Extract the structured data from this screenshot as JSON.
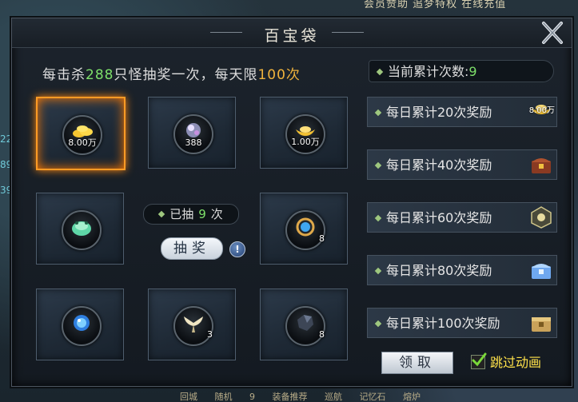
{
  "top_bar": {
    "text": "会员赞助  追梦特权  在线充值"
  },
  "bottom_bar": {
    "items": [
      "回城",
      "随机",
      "9",
      "装备推荐",
      "巡航",
      "记忆石",
      "熔炉"
    ]
  },
  "side_numbers": [
    "22",
    "89",
    "39"
  ],
  "panel": {
    "title": "百宝袋",
    "info": {
      "prefix": "每击杀",
      "kills": "288",
      "middle": "只怪抽奖一次，每天限",
      "limit": "100",
      "suffix": "次"
    },
    "drawn": {
      "label_prefix": "已抽",
      "count": "9",
      "label_suffix": "次"
    },
    "draw_button": "抽奖",
    "info_button": "!",
    "slots": [
      {
        "icon": "gold-ingot-pile-icon",
        "qty": "8.00万",
        "active": true
      },
      {
        "icon": "spirit-orb-icon",
        "qty": "388",
        "active": false
      },
      {
        "icon": "gold-ingot-icon",
        "qty": "1.00万",
        "active": false
      },
      {
        "icon": "jade-frog-icon",
        "qty": "",
        "active": false
      },
      {
        "icon": "blue-gem-ring-icon",
        "qty": "8",
        "active": false
      },
      {
        "icon": "blue-orb-icon",
        "qty": "",
        "active": false
      },
      {
        "icon": "wings-icon",
        "qty": "3",
        "active": false
      },
      {
        "icon": "dark-ore-icon",
        "qty": "8",
        "active": false
      }
    ],
    "current_count": {
      "label": "当前累计次数:",
      "value": "9"
    },
    "rewards": [
      {
        "label": "每日累计20次奖励",
        "icon": "gold-ingot-icon",
        "qty": "8.00万"
      },
      {
        "label": "每日累计40次奖励",
        "icon": "red-treasure-chest-icon",
        "qty": ""
      },
      {
        "label": "每日累计60次奖励",
        "icon": "silver-ornate-chest-icon",
        "qty": ""
      },
      {
        "label": "每日累计80次奖励",
        "icon": "crystal-chest-icon",
        "qty": ""
      },
      {
        "label": "每日累计100次奖励",
        "icon": "gold-chest-icon",
        "qty": ""
      }
    ],
    "claim_button": "领取",
    "skip_animation": {
      "label": "跳过动画",
      "checked": true
    }
  },
  "colors": {
    "accent_green": "#7ee06a",
    "accent_gold": "#f0b33c",
    "active_border": "#ff9b25",
    "skip_yellow": "#ffe24a"
  }
}
